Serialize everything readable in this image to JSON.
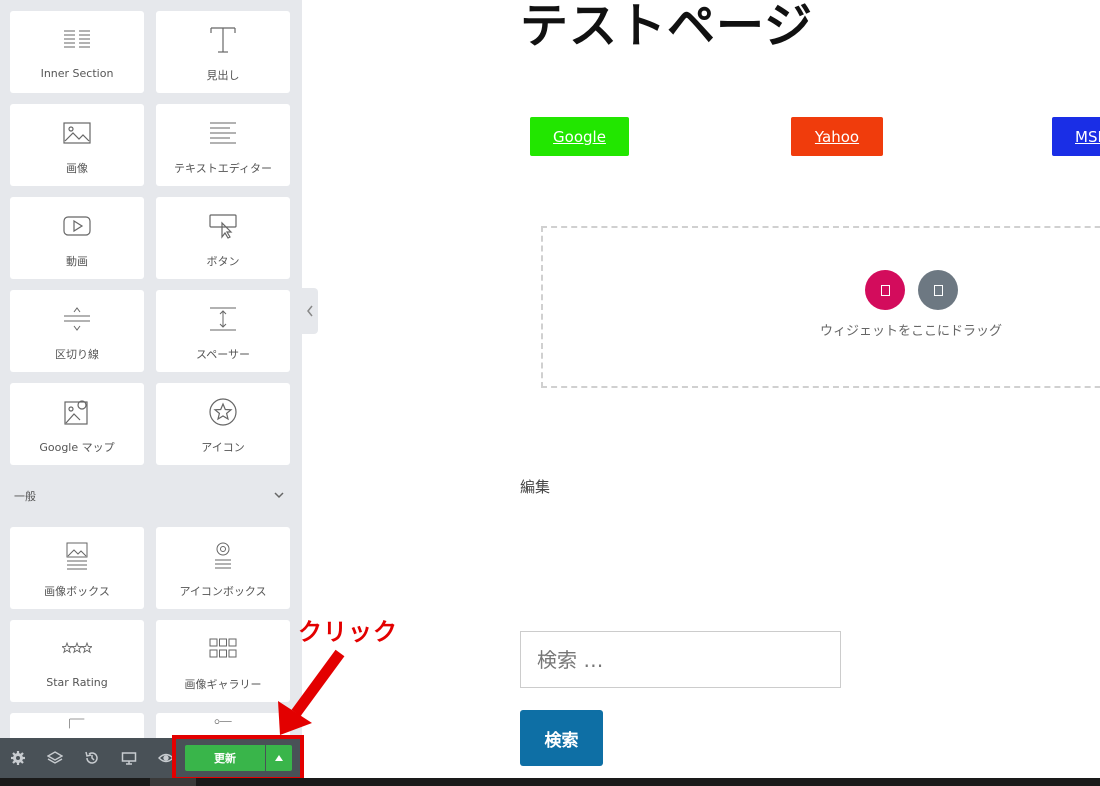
{
  "sidebar": {
    "widgets": [
      {
        "label": "Inner Section",
        "icon": "inner-section-icon"
      },
      {
        "label": "見出し",
        "icon": "heading-icon"
      },
      {
        "label": "画像",
        "icon": "image-icon"
      },
      {
        "label": "テキストエディター",
        "icon": "text-editor-icon"
      },
      {
        "label": "動画",
        "icon": "video-icon"
      },
      {
        "label": "ボタン",
        "icon": "button-icon"
      },
      {
        "label": "区切り線",
        "icon": "divider-icon"
      },
      {
        "label": "スペーサー",
        "icon": "spacer-icon"
      },
      {
        "label": "Google マップ",
        "icon": "google-maps-icon"
      },
      {
        "label": "アイコン",
        "icon": "star-icon"
      }
    ],
    "section_title": "一般",
    "general_widgets": [
      {
        "label": "画像ボックス",
        "icon": "image-box-icon"
      },
      {
        "label": "アイコンボックス",
        "icon": "icon-box-icon"
      },
      {
        "label": "Star Rating",
        "icon": "star-rating-icon"
      },
      {
        "label": "画像ギャラリー",
        "icon": "image-gallery-icon"
      }
    ]
  },
  "bottom_bar": {
    "update_label": "更新",
    "icons": [
      "settings-icon",
      "layers-icon",
      "history-icon",
      "responsive-icon",
      "preview-icon"
    ]
  },
  "annotation": {
    "click_label": "クリック",
    "color": "#e30000"
  },
  "canvas": {
    "page_title": "テストページ",
    "links": [
      {
        "label": "Google",
        "color": "#22e600"
      },
      {
        "label": "Yahoo",
        "color": "#f03c0c"
      },
      {
        "label": "MSN",
        "color": "#1a2ee6"
      }
    ],
    "dropzone_text": "ウィジェットをここにドラッグ",
    "dropzone_colors": [
      "#d30c5c",
      "#6d7882"
    ],
    "edit_text": "編集",
    "search_placeholder": "検索 …",
    "search_button": "検索"
  }
}
